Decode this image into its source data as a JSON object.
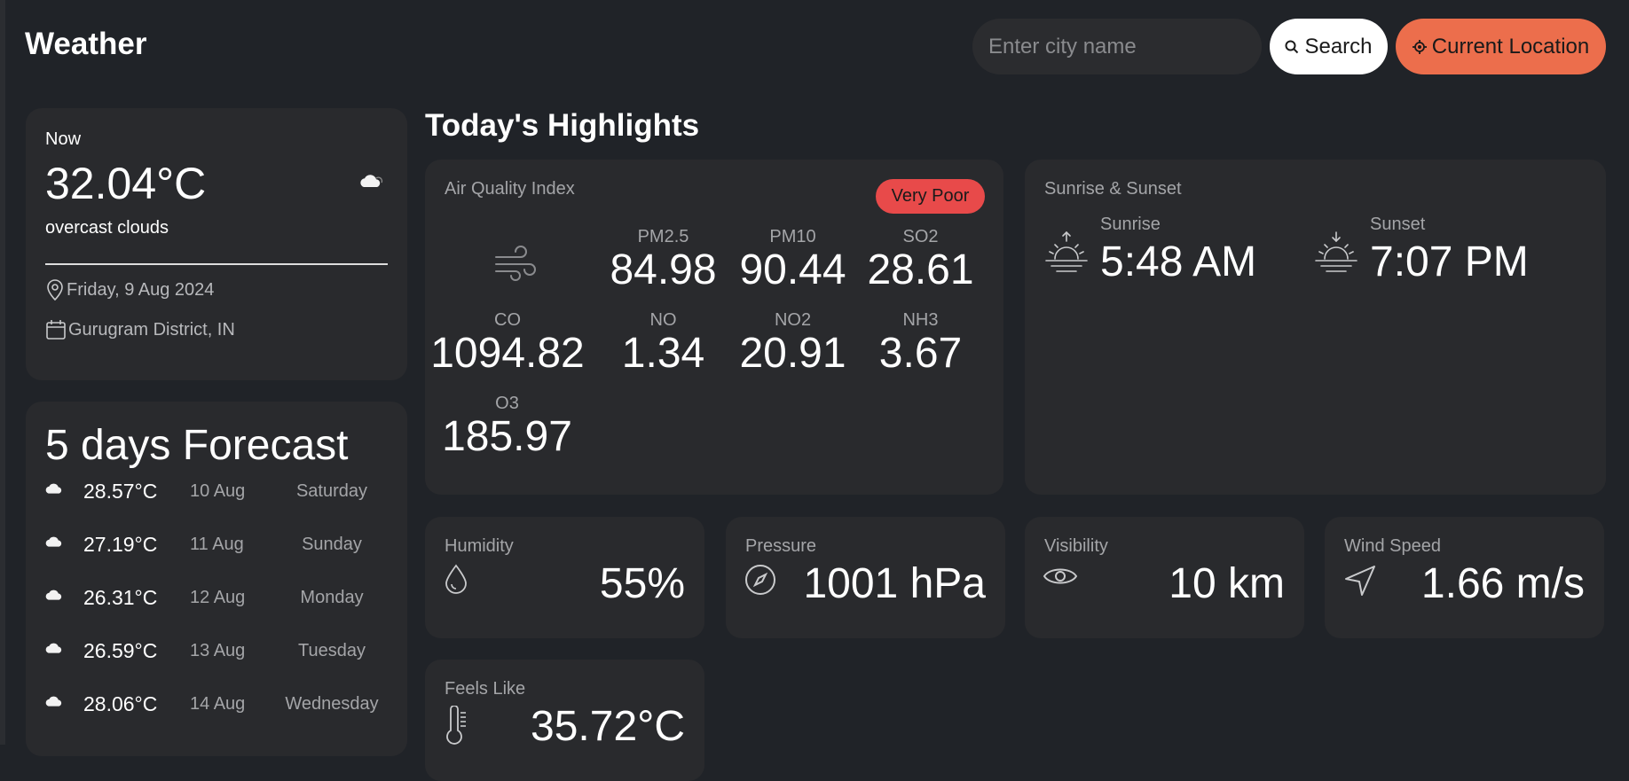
{
  "app": {
    "title": "Weather"
  },
  "search": {
    "placeholder": "Enter city name",
    "button_label": "Search"
  },
  "location_button": {
    "label": "Current Location"
  },
  "current": {
    "label": "Now",
    "temperature": "32.04°C",
    "condition": "overcast clouds",
    "condition_icon": "cloud-icon",
    "date": "Friday, 9 Aug 2024",
    "location": "Gurugram District, IN"
  },
  "forecast": {
    "title": "5 days Forecast",
    "days": [
      {
        "temp": "28.57°C",
        "date": "10 Aug",
        "day": "Saturday",
        "icon": "cloud-icon"
      },
      {
        "temp": "27.19°C",
        "date": "11 Aug",
        "day": "Sunday",
        "icon": "cloud-icon"
      },
      {
        "temp": "26.31°C",
        "date": "12 Aug",
        "day": "Monday",
        "icon": "cloud-icon"
      },
      {
        "temp": "26.59°C",
        "date": "13 Aug",
        "day": "Tuesday",
        "icon": "cloud-icon"
      },
      {
        "temp": "28.06°C",
        "date": "14 Aug",
        "day": "Wednesday",
        "icon": "cloud-icon"
      }
    ]
  },
  "highlights": {
    "title": "Today's Highlights",
    "aqi": {
      "label": "Air Quality Index",
      "status": "Very Poor",
      "status_color": "#e84a4a",
      "items": [
        {
          "name": "PM2.5",
          "value": "84.98"
        },
        {
          "name": "PM10",
          "value": "90.44"
        },
        {
          "name": "SO2",
          "value": "28.61"
        },
        {
          "name": "CO",
          "value": "1094.82"
        },
        {
          "name": "NO",
          "value": "1.34"
        },
        {
          "name": "NO2",
          "value": "20.91"
        },
        {
          "name": "NH3",
          "value": "3.67"
        },
        {
          "name": "O3",
          "value": "185.97"
        }
      ]
    },
    "sun": {
      "label": "Sunrise & Sunset",
      "sunrise_label": "Sunrise",
      "sunrise": "5:48 AM",
      "sunset_label": "Sunset",
      "sunset": "7:07 PM"
    },
    "humidity": {
      "label": "Humidity",
      "value": "55%"
    },
    "pressure": {
      "label": "Pressure",
      "value": "1001 hPa"
    },
    "visibility": {
      "label": "Visibility",
      "value": "10 km"
    },
    "wind": {
      "label": "Wind Speed",
      "value": "1.66 m/s"
    },
    "feels_like": {
      "label": "Feels Like",
      "value": "35.72°C"
    }
  },
  "colors": {
    "background": "#202328",
    "card": "#292a2d",
    "accent": "#ec6e4c",
    "badge": "#e84a4a"
  }
}
